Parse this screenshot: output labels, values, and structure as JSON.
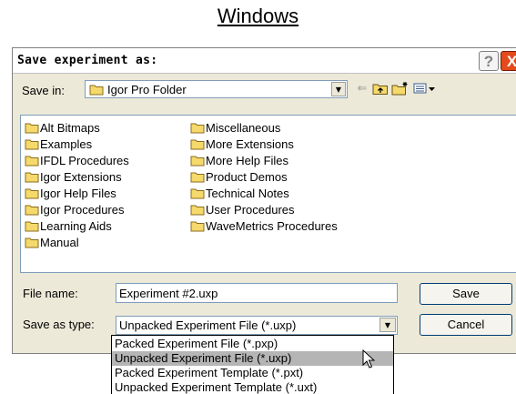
{
  "page_heading": "Windows",
  "dialog": {
    "title": "Save experiment as:",
    "help_glyph": "?",
    "close_glyph": "X",
    "save_in_label": "Save in:",
    "save_in_value": "Igor Pro Folder",
    "file_list": {
      "column1": [
        "Alt Bitmaps",
        "Examples",
        "IFDL Procedures",
        "Igor Extensions",
        "Igor Help Files",
        "Igor Procedures",
        "Learning Aids",
        "Manual"
      ],
      "column2": [
        "Miscellaneous",
        "More Extensions",
        "More Help Files",
        "Product Demos",
        "Technical Notes",
        "User Procedures",
        "WaveMetrics Procedures"
      ]
    },
    "file_name_label": "File name:",
    "file_name_value": "Experiment #2.uxp",
    "save_as_type_label": "Save as type:",
    "save_as_type_value": "Unpacked Experiment File (*.uxp)",
    "save_button": "Save",
    "cancel_button": "Cancel",
    "type_options": [
      "Packed Experiment File (*.pxp)",
      "Unpacked Experiment File (*.uxp)",
      "Packed Experiment Template (*.pxt)",
      "Unpacked Experiment Template (*.uxt)"
    ],
    "selected_type_index": 1
  },
  "icons": {
    "folder": "folder-icon",
    "back": "back-arrow-icon",
    "up": "up-folder-icon",
    "new_folder": "new-folder-icon",
    "views": "views-menu-icon",
    "dropdown": "chevron-down-icon",
    "cursor": "mouse-pointer-icon"
  },
  "colors": {
    "dialog_bg": "#ece9d8",
    "close_red": "#e34a1c",
    "selection": "#b5b5b5",
    "folder_yellow": "#f5d96b"
  }
}
